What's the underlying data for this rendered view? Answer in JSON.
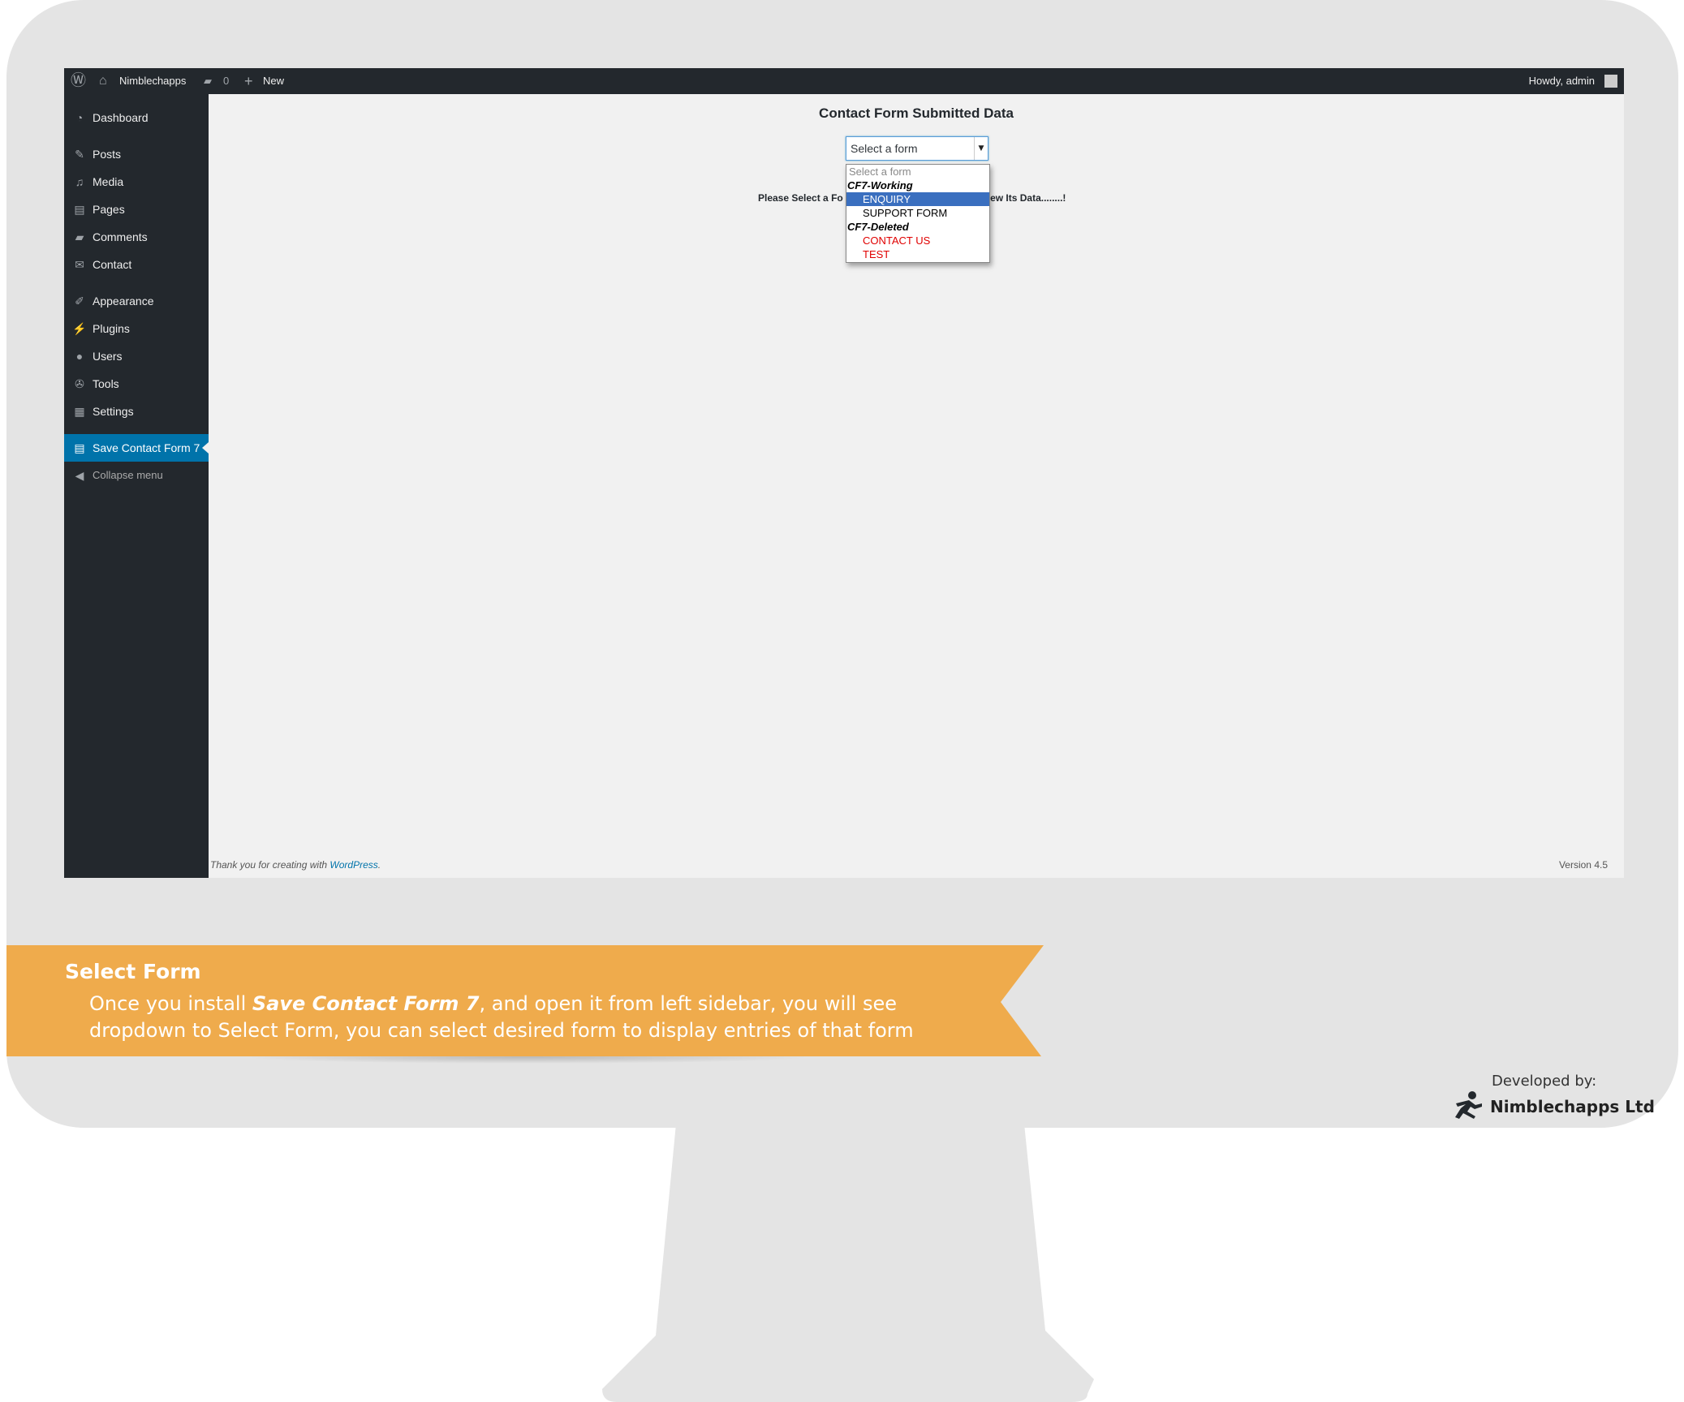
{
  "admin_bar": {
    "site_name": "Nimblechapps",
    "comments_count": "0",
    "new_label": "New",
    "greeting": "Howdy, admin"
  },
  "sidebar": {
    "items": [
      {
        "label": "Dashboard",
        "icon": "dashboard-icon"
      },
      {
        "label": "Posts",
        "icon": "pin-icon"
      },
      {
        "label": "Media",
        "icon": "media-icon"
      },
      {
        "label": "Pages",
        "icon": "pages-icon"
      },
      {
        "label": "Comments",
        "icon": "comment-icon"
      },
      {
        "label": "Contact",
        "icon": "envelope-icon"
      },
      {
        "label": "Appearance",
        "icon": "brush-icon"
      },
      {
        "label": "Plugins",
        "icon": "plug-icon"
      },
      {
        "label": "Users",
        "icon": "user-icon"
      },
      {
        "label": "Tools",
        "icon": "wrench-icon"
      },
      {
        "label": "Settings",
        "icon": "settings-icon"
      },
      {
        "label": "Save Contact Form 7",
        "icon": "form-icon",
        "current": true
      },
      {
        "label": "Collapse menu",
        "icon": "collapse-icon"
      }
    ]
  },
  "main": {
    "title": "Contact Form Submitted Data",
    "select": {
      "value": "Select a form",
      "hint_left": "Please Select a Fo",
      "hint_right": "iew Its Data........!"
    },
    "dropdown": {
      "placeholder": "Select a form",
      "groups": [
        {
          "label": "CF7-Working",
          "options": [
            "ENQUIRY",
            "SUPPORT FORM"
          ],
          "selected": "ENQUIRY"
        },
        {
          "label": "CF7-Deleted",
          "options": [
            "CONTACT US",
            "TEST"
          ]
        }
      ]
    }
  },
  "footer": {
    "thanks": "Thank you for creating with ",
    "wp_link": "WordPress",
    "period": ".",
    "version": "Version 4.5"
  },
  "banner": {
    "title": "Select Form",
    "text_before": "Once you install ",
    "text_emphasis": "Save Contact Form 7",
    "text_after": ", and open it from left sidebar, you will see dropdown to Select Form, you can select desired form to display entries of that form",
    "color": "#efab4c"
  },
  "developer": {
    "label": "Developed by:",
    "name": "Nimblechapps Ltd"
  },
  "colors": {
    "admin_dark": "#23282d",
    "accent": "#0073aa",
    "selected_option": "#3a6fbf",
    "deleted_option": "#e00000",
    "monitor": "#e4e4e4"
  }
}
